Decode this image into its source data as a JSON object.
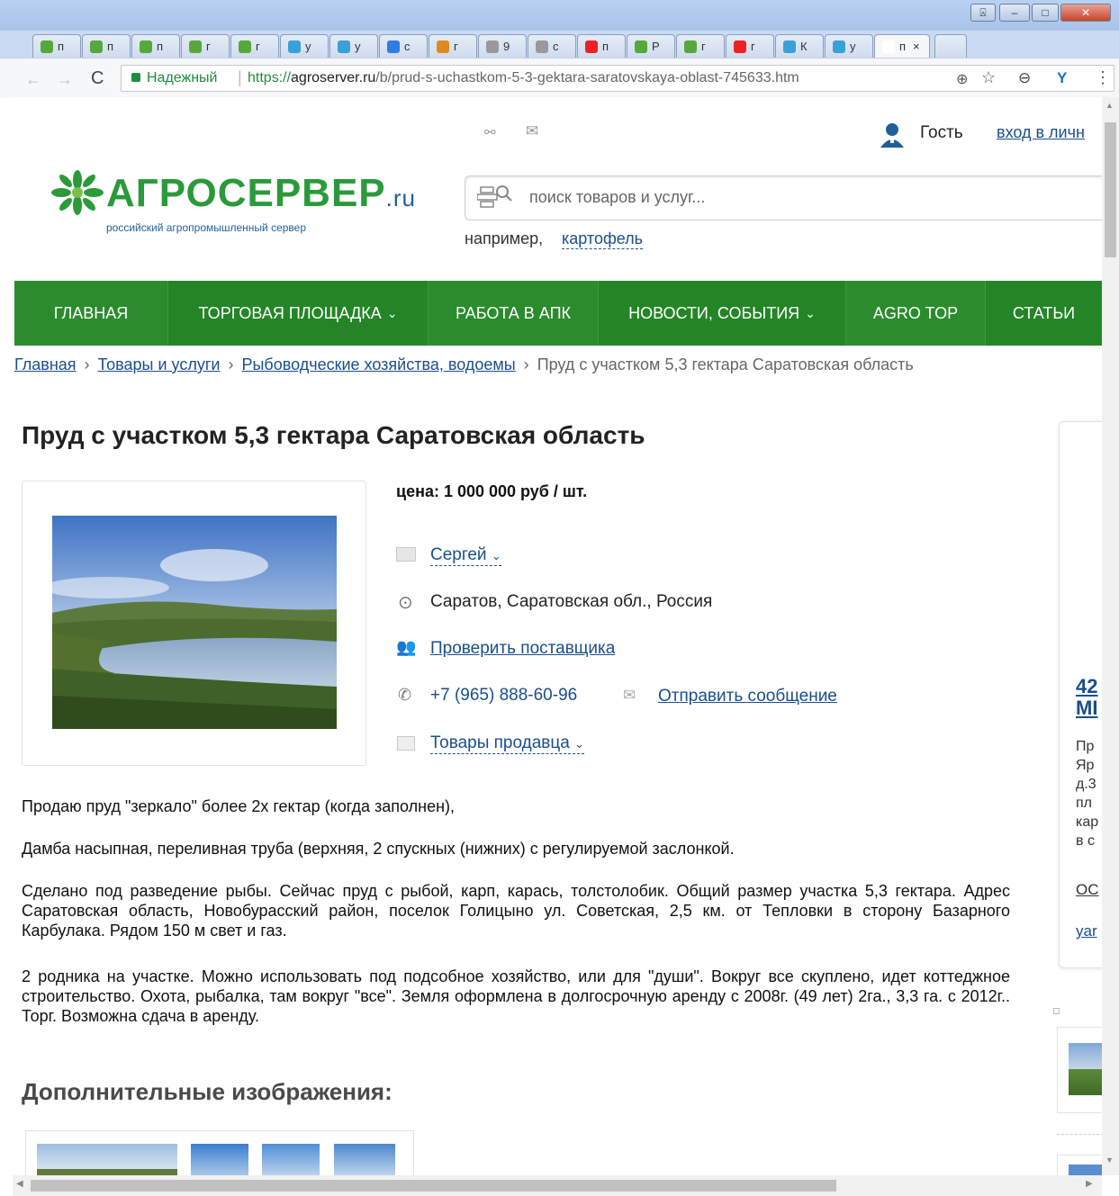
{
  "browser": {
    "tabs": [
      "п",
      "п",
      "п",
      "г",
      "г",
      "у",
      "у",
      "с",
      "г",
      "9",
      "с",
      "п",
      "Р",
      "г",
      "г",
      "К",
      "у",
      "п"
    ],
    "active_tab_close": "×",
    "secure_label": "Надежный",
    "url_scheme": "https://",
    "url_host": "agroserver.ru",
    "url_path": "/b/prud-s-uchastkom-5-3-gektara-saratovskaya-oblast-745633.htm"
  },
  "header": {
    "logo_main": "АГРОСЕРВЕР",
    "logo_suffix": ".ru",
    "logo_tagline": "российский агропромышленный сервер",
    "user_label": "Гость",
    "login_link": "вход в личн",
    "search_placeholder": "поиск товаров и услуг...",
    "example_prefix": "например,",
    "example_link": "картофель"
  },
  "nav": {
    "items": [
      "ГЛАВНАЯ",
      "ТОРГОВАЯ ПЛОЩАДКА",
      "РАБОТА В АПК",
      "НОВОСТИ, СОБЫТИЯ",
      "AGRO TOP",
      "СТАТЬИ"
    ]
  },
  "breadcrumb": {
    "items": [
      "Главная",
      "Товары и услуги",
      "Рыбоводческие хозяйства, водоемы"
    ],
    "current": "Пруд с участком 5,3 гектара Саратовская область"
  },
  "listing": {
    "title": "Пруд с участком 5,3 гектара Саратовская область",
    "price": "цена: 1 000 000 руб / шт.",
    "seller": "Сергей",
    "location": "Саратов, Саратовская обл., Россия",
    "check_supplier": "Проверить поставщика",
    "phone": "+7 (965) 888-60-96",
    "send_message": "Отправить сообщение",
    "seller_goods": "Товары продавца",
    "paragraphs": [
      "Продаю пруд \"зеркало\" более 2х гектар (когда заполнен),",
      "Дамба насыпная, переливная труба (верхняя, 2 спускных (нижних) с регулируемой заслонкой.",
      "Сделано под разведение рыбы. Сейчас пруд с рыбой, карп, карась, толстолобик. Общий размер участка 5,3 гектара. Адрес Саратовская область, Новобурасский район, поселок Голицыно ул. Советская, 2,5 км. от Тепловки в сторону Базарного Карбулака. Рядом 150 м свет и газ.",
      "2 родника на участке. Можно использовать под подсобное хозяйство, или для \"души\". Вокруг все скуплено, идет коттеджное строительство. Охота, рыбалка, там вокруг \"все\". Земля оформлена в долгосрочную аренду с 2008г. (49 лет) 2га., 3,3 га. с 2012г.. Торг. Возможна сдача в аренду."
    ],
    "extra_images_title": "Дополнительные изображения:"
  },
  "sidebar_ad": {
    "title_lines": [
      "42",
      "МІ"
    ],
    "text_lines": [
      "Пр",
      "Яр",
      "д.3",
      "пл",
      "кар",
      "в с"
    ],
    "link1": "ОС",
    "link2": "yar"
  },
  "colors": {
    "nav_green": "#2b8c2e",
    "link_blue": "#1a4e8c",
    "logo_green": "#2b9a3a",
    "logo_blue": "#1f5f9a"
  }
}
